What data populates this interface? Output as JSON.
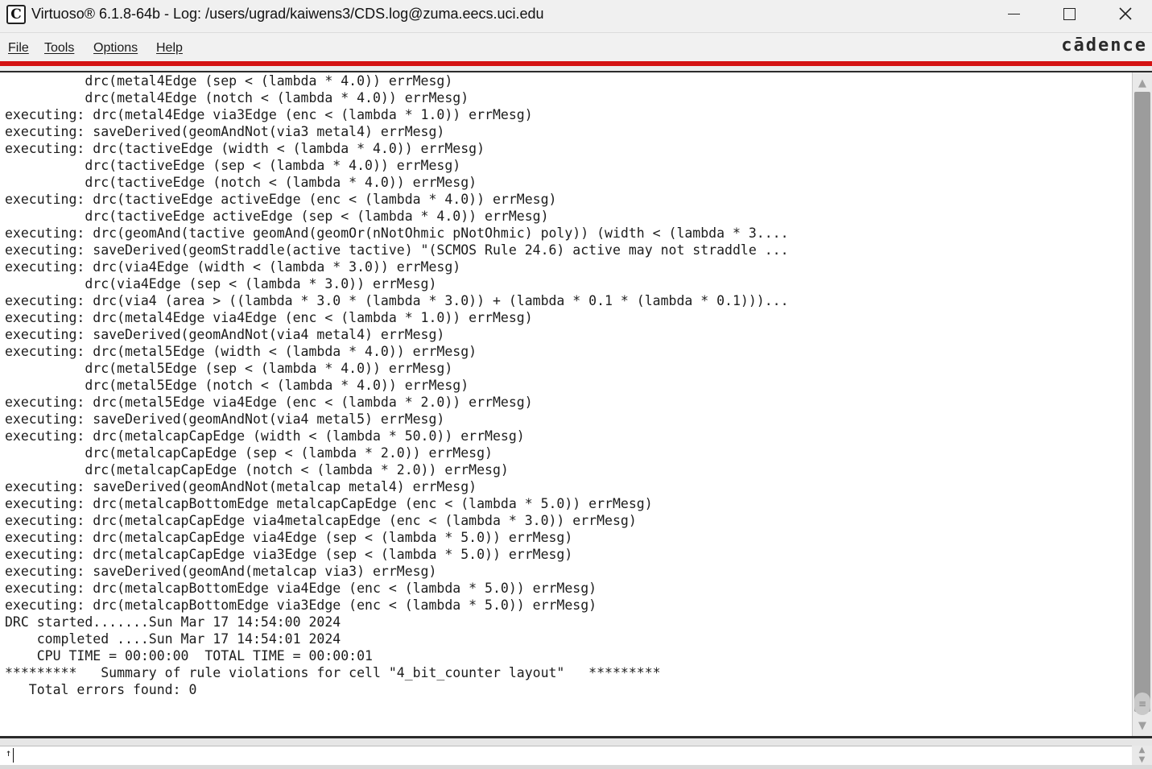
{
  "window": {
    "app_icon": "C",
    "title": "Virtuoso® 6.1.8-64b - Log: /users/ugrad/kaiwens3/CDS.log@zuma.eecs.uci.edu",
    "minimize_icon": "minimize-icon",
    "maximize_icon": "maximize-icon",
    "close_glyph": "✕"
  },
  "menu": {
    "file": "File",
    "tools": "Tools",
    "options": "Options",
    "help": "Help"
  },
  "brand": "cādence",
  "colors": {
    "accent_red": "#d41212",
    "scroll_thumb": "#9c9c9c"
  },
  "log": {
    "lines": [
      "          drc(metal4Edge (sep < (lambda * 4.0)) errMesg)",
      "          drc(metal4Edge (notch < (lambda * 4.0)) errMesg)",
      "executing: drc(metal4Edge via3Edge (enc < (lambda * 1.0)) errMesg)",
      "executing: saveDerived(geomAndNot(via3 metal4) errMesg)",
      "executing: drc(tactiveEdge (width < (lambda * 4.0)) errMesg)",
      "          drc(tactiveEdge (sep < (lambda * 4.0)) errMesg)",
      "          drc(tactiveEdge (notch < (lambda * 4.0)) errMesg)",
      "executing: drc(tactiveEdge activeEdge (enc < (lambda * 4.0)) errMesg)",
      "          drc(tactiveEdge activeEdge (sep < (lambda * 4.0)) errMesg)",
      "executing: drc(geomAnd(tactive geomAnd(geomOr(nNotOhmic pNotOhmic) poly)) (width < (lambda * 3....",
      "executing: saveDerived(geomStraddle(active tactive) \"(SCMOS Rule 24.6) active may not straddle ...",
      "executing: drc(via4Edge (width < (lambda * 3.0)) errMesg)",
      "          drc(via4Edge (sep < (lambda * 3.0)) errMesg)",
      "executing: drc(via4 (area > ((lambda * 3.0 * (lambda * 3.0)) + (lambda * 0.1 * (lambda * 0.1)))...",
      "executing: drc(metal4Edge via4Edge (enc < (lambda * 1.0)) errMesg)",
      "executing: saveDerived(geomAndNot(via4 metal4) errMesg)",
      "executing: drc(metal5Edge (width < (lambda * 4.0)) errMesg)",
      "          drc(metal5Edge (sep < (lambda * 4.0)) errMesg)",
      "          drc(metal5Edge (notch < (lambda * 4.0)) errMesg)",
      "executing: drc(metal5Edge via4Edge (enc < (lambda * 2.0)) errMesg)",
      "executing: saveDerived(geomAndNot(via4 metal5) errMesg)",
      "executing: drc(metalcapCapEdge (width < (lambda * 50.0)) errMesg)",
      "          drc(metalcapCapEdge (sep < (lambda * 2.0)) errMesg)",
      "          drc(metalcapCapEdge (notch < (lambda * 2.0)) errMesg)",
      "executing: saveDerived(geomAndNot(metalcap metal4) errMesg)",
      "executing: drc(metalcapBottomEdge metalcapCapEdge (enc < (lambda * 5.0)) errMesg)",
      "executing: drc(metalcapCapEdge via4metalcapEdge (enc < (lambda * 3.0)) errMesg)",
      "executing: drc(metalcapCapEdge via4Edge (sep < (lambda * 5.0)) errMesg)",
      "executing: drc(metalcapCapEdge via3Edge (sep < (lambda * 5.0)) errMesg)",
      "executing: saveDerived(geomAnd(metalcap via3) errMesg)",
      "executing: drc(metalcapBottomEdge via4Edge (enc < (lambda * 5.0)) errMesg)",
      "executing: drc(metalcapBottomEdge via3Edge (enc < (lambda * 5.0)) errMesg)",
      "DRC started.......Sun Mar 17 14:54:00 2024",
      "    completed ....Sun Mar 17 14:54:01 2024",
      "    CPU TIME = 00:00:00  TOTAL TIME = 00:00:01",
      "*********   Summary of rule violations for cell \"4_bit_counter layout\"   *********",
      "   Total errors found: 0"
    ]
  },
  "command": {
    "prompt": "↑",
    "value": ""
  }
}
